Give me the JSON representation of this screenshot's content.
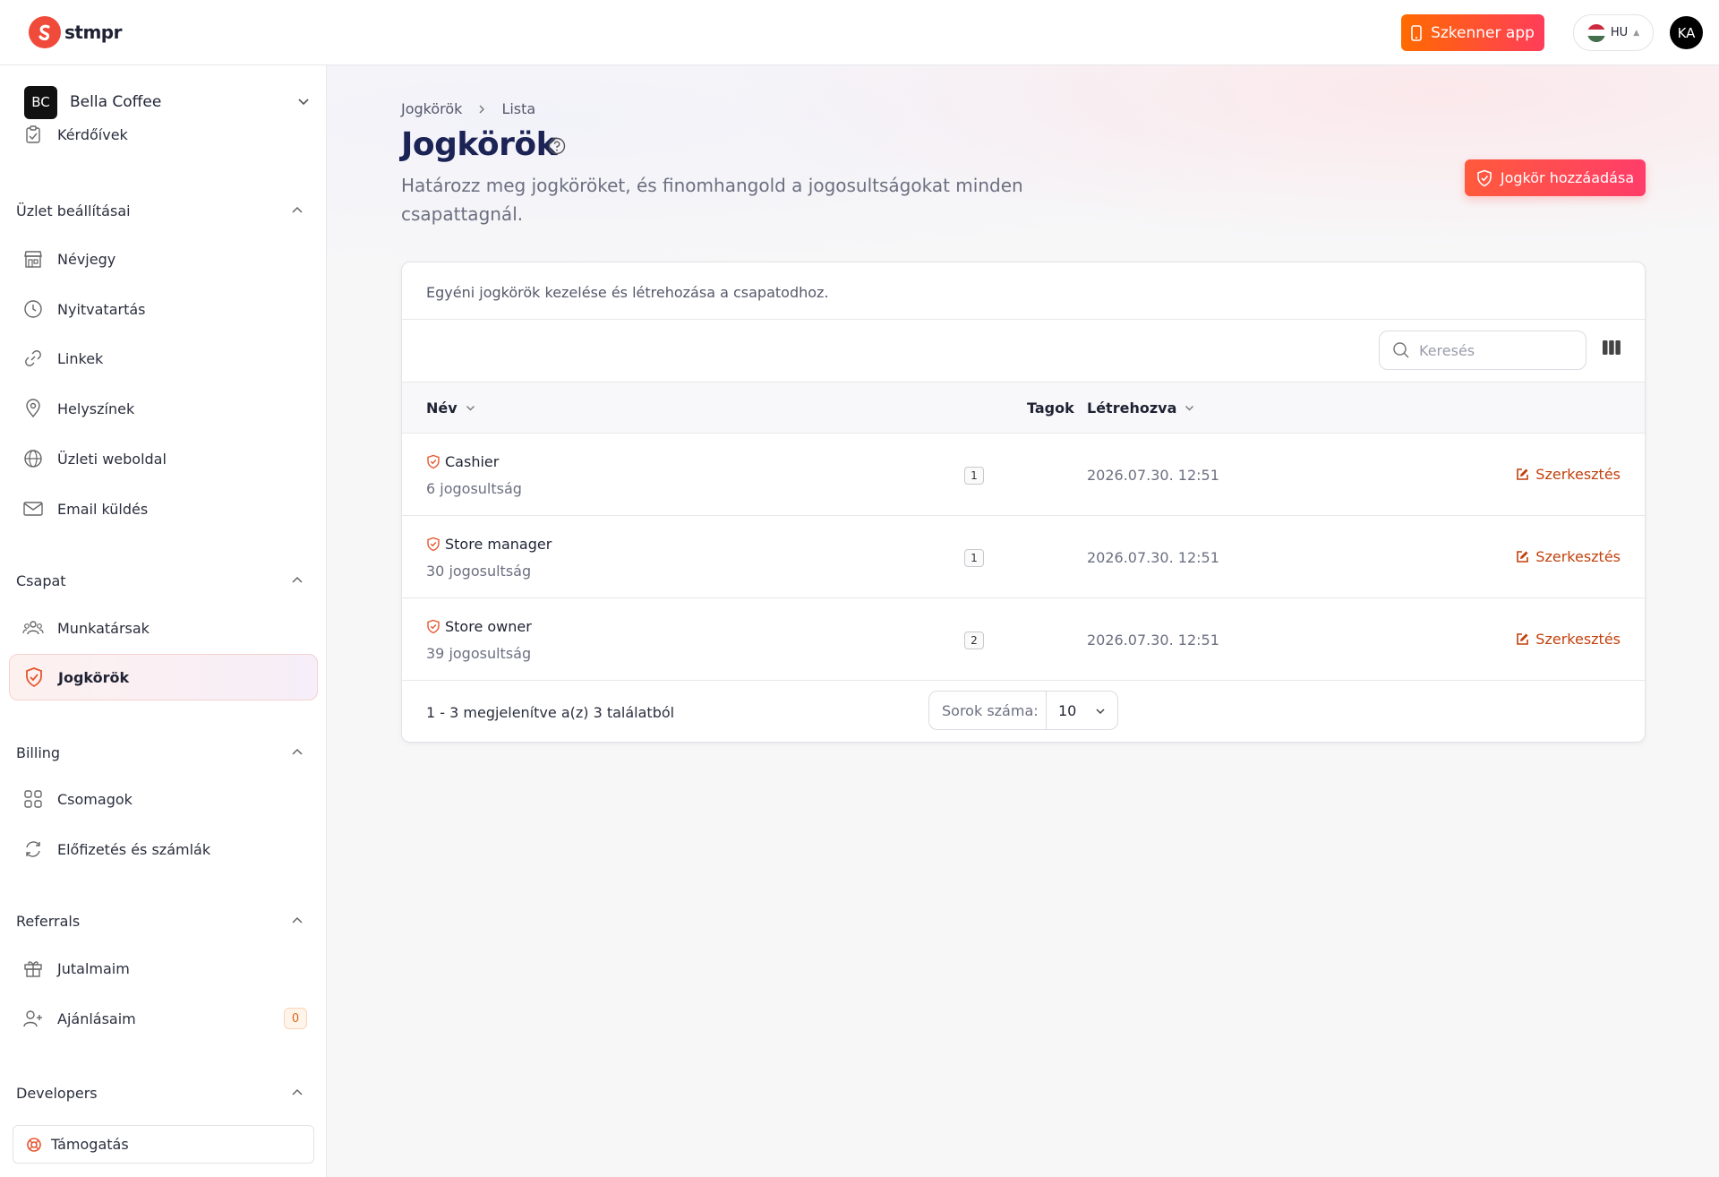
{
  "app": {
    "logo_text": "stmpr",
    "scanner_label": "Szkenner app",
    "language": "HU",
    "user_initials": "KA"
  },
  "sidebar": {
    "org": {
      "initials": "BC",
      "name": "Bella Coffee"
    },
    "items_top": [
      {
        "label": "Kérdőívek",
        "icon": "clipboard-icon"
      }
    ],
    "sections": [
      {
        "title": "Üzlet beállításai",
        "items": [
          {
            "label": "Névjegy",
            "icon": "store-icon"
          },
          {
            "label": "Nyitvatartás",
            "icon": "clock-icon"
          },
          {
            "label": "Linkek",
            "icon": "link-icon"
          },
          {
            "label": "Helyszínek",
            "icon": "map-pin-icon"
          },
          {
            "label": "Üzleti weboldal",
            "icon": "globe-icon"
          },
          {
            "label": "Email küldés",
            "icon": "mail-icon"
          }
        ]
      },
      {
        "title": "Csapat",
        "items": [
          {
            "label": "Munkatársak",
            "icon": "users-icon"
          },
          {
            "label": "Jogkörök",
            "icon": "shield-icon",
            "active": true
          }
        ]
      },
      {
        "title": "Billing",
        "items": [
          {
            "label": "Csomagok",
            "icon": "grid-icon"
          },
          {
            "label": "Előfizetés és számlák",
            "icon": "refresh-icon"
          }
        ]
      },
      {
        "title": "Referrals",
        "items": [
          {
            "label": "Jutalmaim",
            "icon": "gift-icon"
          },
          {
            "label": "Ajánlásaim",
            "icon": "user-plus-icon",
            "badge": "0"
          }
        ]
      },
      {
        "title": "Developers",
        "items": []
      }
    ],
    "support_label": "Támogatás"
  },
  "page": {
    "breadcrumb": [
      "Jogkörök",
      "Lista"
    ],
    "title": "Jogkörök",
    "subtitle": "Határozz meg jogköröket, és finomhangold a jogosultságokat minden csapattagnál.",
    "add_button": "Jogkör hozzáadása"
  },
  "table": {
    "description": "Egyéni jogkörök kezelése és létrehozása a csapatodhoz.",
    "search_placeholder": "Keresés",
    "columns": {
      "name": "Név",
      "members": "Tagok",
      "created": "Létrehozva"
    },
    "rows": [
      {
        "name": "Cashier",
        "permissions": "6 jogosultság",
        "members": "1",
        "created": "2026.07.30. 12:51",
        "action": "Szerkesztés"
      },
      {
        "name": "Store manager",
        "permissions": "30 jogosultság",
        "members": "1",
        "created": "2026.07.30. 12:51",
        "action": "Szerkesztés"
      },
      {
        "name": "Store owner",
        "permissions": "39 jogosultság",
        "members": "2",
        "created": "2026.07.30. 12:51",
        "action": "Szerkesztés"
      }
    ],
    "footer_text": "1 - 3 megjelenítve a(z) 3 találatból",
    "rows_per_page_label": "Sorok száma:",
    "rows_per_page_value": "10"
  },
  "colors": {
    "accent": "#f04a3a",
    "title": "#1c2355",
    "edit": "#c2410c"
  }
}
